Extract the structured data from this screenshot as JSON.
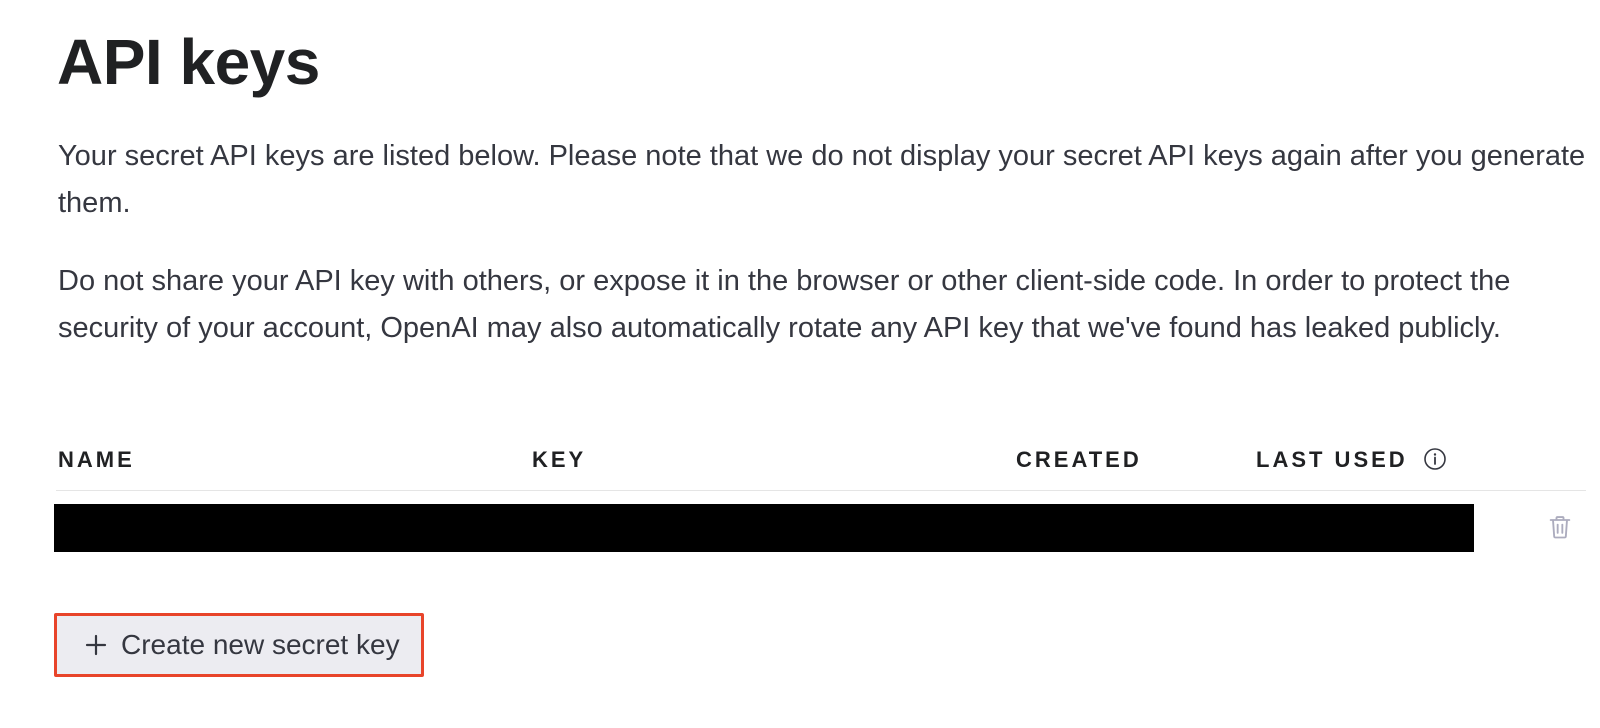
{
  "page": {
    "title": "API keys",
    "description_1": "Your secret API keys are listed below. Please note that we do not display your secret API keys again after you generate them.",
    "description_2": "Do not share your API key with others, or expose it in the browser or other client-side code. In order to protect the security of your account, OpenAI may also automatically rotate any API key that we've found has leaked publicly."
  },
  "table": {
    "columns": [
      "NAME",
      "KEY",
      "CREATED",
      "LAST USED"
    ],
    "last_used_icon": "info-icon",
    "rows": [
      {
        "redacted": true,
        "action_icon": "trash-icon"
      }
    ]
  },
  "actions": {
    "create_label": "Create new secret key",
    "create_icon": "plus-icon"
  },
  "colors": {
    "highlight_border": "#e8442a",
    "button_bg": "#ececf1",
    "text": "#353740",
    "heading": "#202123"
  }
}
